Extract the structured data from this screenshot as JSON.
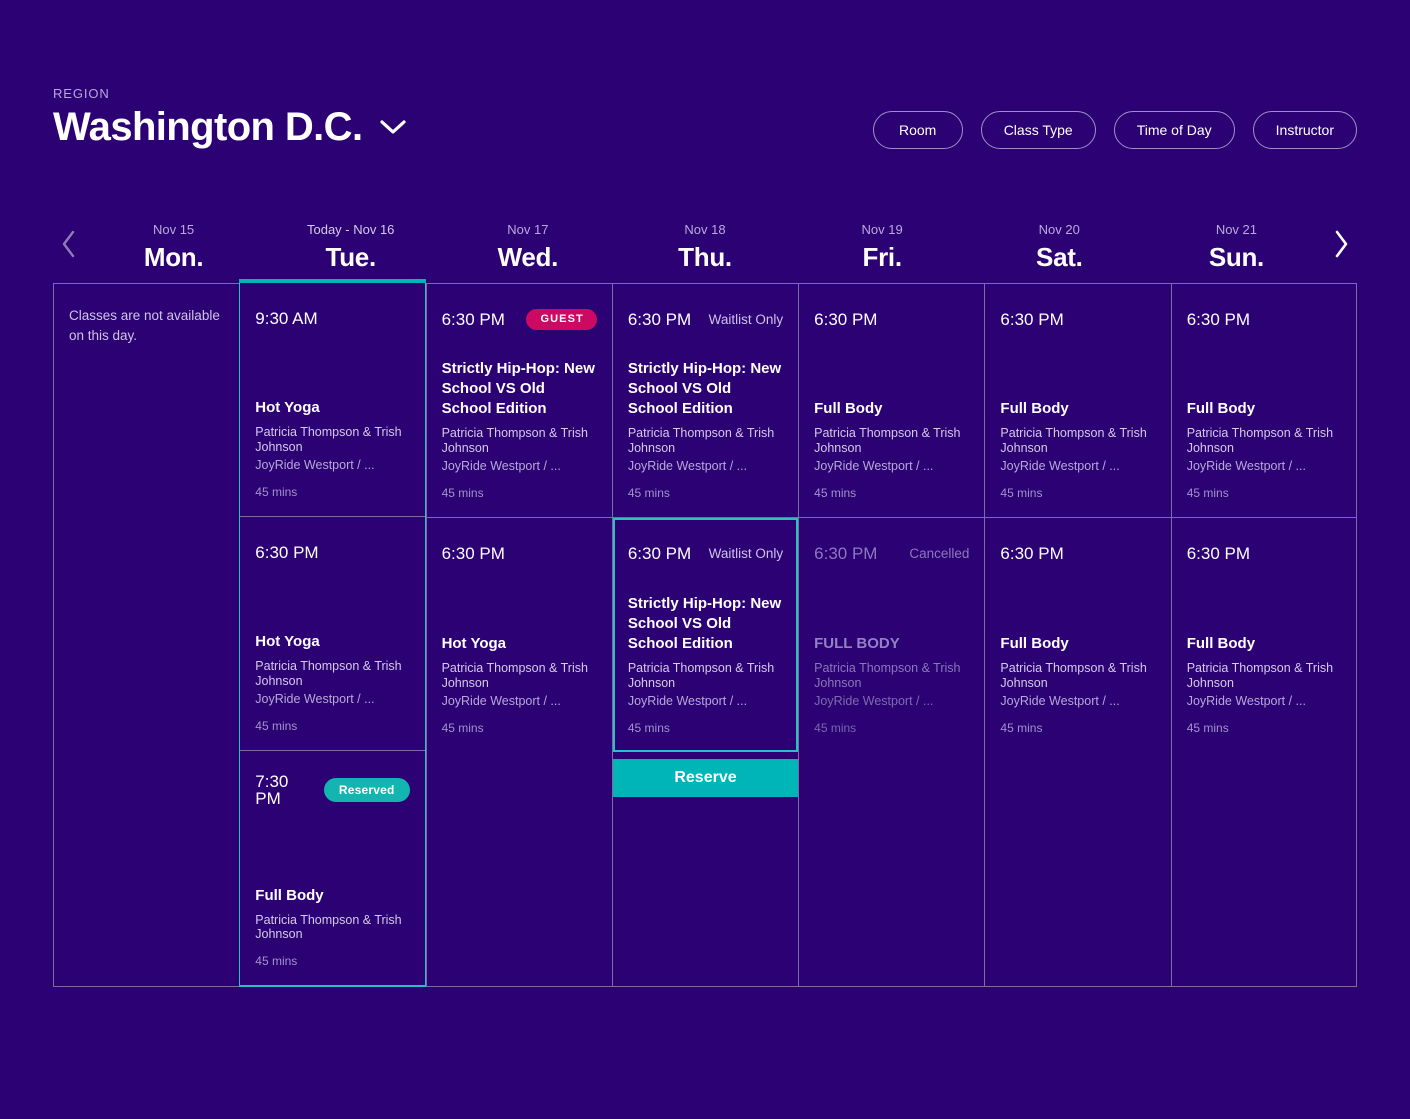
{
  "header": {
    "region_label": "REGION",
    "region_name": "Washington D.C.",
    "chevron_icon": "chevron-down-icon",
    "filters": [
      {
        "label": "Room"
      },
      {
        "label": "Class Type"
      },
      {
        "label": "Time of Day"
      },
      {
        "label": "Instructor"
      }
    ]
  },
  "nav": {
    "prev_icon": "chevron-left-icon",
    "next_icon": "chevron-right-icon"
  },
  "colors": {
    "background": "#2b0174",
    "accent_teal": "#00b5b8",
    "badge_guest": "#cc0a63",
    "badge_reserved": "#13b5b1",
    "grid_border": "#7b6ca4"
  },
  "days": [
    {
      "date": "Nov 15",
      "name": "Mon.",
      "today": false
    },
    {
      "date": "Today - Nov 16",
      "name": "Tue.",
      "today": true
    },
    {
      "date": "Nov 17",
      "name": "Wed.",
      "today": false
    },
    {
      "date": "Nov 18",
      "name": "Thu.",
      "today": false
    },
    {
      "date": "Nov 19",
      "name": "Fri.",
      "today": false
    },
    {
      "date": "Nov 20",
      "name": "Sat.",
      "today": false
    },
    {
      "date": "Nov 21",
      "name": "Sun.",
      "today": false
    }
  ],
  "columns": [
    {
      "day": "Mon.",
      "empty_note": "Classes are not available on this day.",
      "cells": []
    },
    {
      "day": "Tue.",
      "cells": [
        {
          "time": "9:30 AM",
          "status": "",
          "badge": "",
          "title": "Hot Yoga",
          "instructor": "Patricia Thompson & Trish Johnson",
          "location": "JoyRide Westport / ...",
          "duration": "45 mins",
          "state": "normal"
        },
        {
          "time": "6:30 PM",
          "status": "",
          "badge": "",
          "title": "Hot Yoga",
          "instructor": "Patricia Thompson & Trish Johnson",
          "location": "JoyRide Westport / ...",
          "duration": "45 mins",
          "state": "normal"
        },
        {
          "time": "7:30 PM",
          "status": "",
          "badge": "Reserved",
          "badge_kind": "reserved",
          "title": "Full Body",
          "instructor": "Patricia Thompson & Trish Johnson",
          "location": "",
          "duration": "45 mins",
          "state": "normal"
        }
      ]
    },
    {
      "day": "Wed.",
      "cells": [
        {
          "time": "6:30 PM",
          "status": "",
          "badge": "GUEST",
          "badge_kind": "guest",
          "title": "Strictly Hip-Hop: New School VS Old School Edition",
          "instructor": "Patricia Thompson & Trish Johnson",
          "location": "JoyRide Westport / ...",
          "duration": "45 mins",
          "state": "normal"
        },
        {
          "time": "6:30 PM",
          "status": "",
          "badge": "",
          "title": "Hot Yoga",
          "instructor": "Patricia Thompson & Trish Johnson",
          "location": "JoyRide Westport / ...",
          "duration": "45 mins",
          "state": "normal"
        }
      ]
    },
    {
      "day": "Thu.",
      "cells": [
        {
          "time": "6:30 PM",
          "status": "Waitlist Only",
          "badge": "",
          "title": "Strictly Hip-Hop: New School VS Old School Edition",
          "instructor": "Patricia Thompson & Trish Johnson",
          "location": "JoyRide Westport / ...",
          "duration": "45 mins",
          "state": "normal"
        },
        {
          "time": "6:30 PM",
          "status": "Waitlist Only",
          "badge": "",
          "title": "Strictly Hip-Hop: New School VS Old School Edition",
          "instructor": "Patricia Thompson & Trish Johnson",
          "location": "JoyRide Westport / ...",
          "duration": "45 mins",
          "state": "selected",
          "action_label": "Reserve"
        }
      ]
    },
    {
      "day": "Fri.",
      "cells": [
        {
          "time": "6:30 PM",
          "status": "",
          "badge": "",
          "title": "Full Body",
          "instructor": "Patricia Thompson & Trish Johnson",
          "location": "JoyRide Westport / ...",
          "duration": "45 mins",
          "state": "normal"
        },
        {
          "time": "6:30 PM",
          "status": "Cancelled",
          "badge": "",
          "title": "FULL BODY",
          "instructor": "Patricia Thompson & Trish Johnson",
          "location": "JoyRide Westport / ...",
          "duration": "45 mins",
          "state": "cancelled"
        }
      ]
    },
    {
      "day": "Sat.",
      "cells": [
        {
          "time": "6:30 PM",
          "status": "",
          "badge": "",
          "title": "Full Body",
          "instructor": "Patricia Thompson & Trish Johnson",
          "location": "JoyRide Westport / ...",
          "duration": "45 mins",
          "state": "normal"
        },
        {
          "time": "6:30 PM",
          "status": "",
          "badge": "",
          "title": "Full Body",
          "instructor": "Patricia Thompson & Trish Johnson",
          "location": "JoyRide Westport / ...",
          "duration": "45 mins",
          "state": "normal"
        }
      ]
    },
    {
      "day": "Sun.",
      "cells": [
        {
          "time": "6:30 PM",
          "status": "",
          "badge": "",
          "title": "Full Body",
          "instructor": "Patricia Thompson & Trish Johnson",
          "location": "JoyRide Westport / ...",
          "duration": "45 mins",
          "state": "normal"
        },
        {
          "time": "6:30 PM",
          "status": "",
          "badge": "",
          "title": "Full Body",
          "instructor": "Patricia Thompson & Trish Johnson",
          "location": "JoyRide Westport / ...",
          "duration": "45 mins",
          "state": "normal"
        }
      ]
    }
  ]
}
